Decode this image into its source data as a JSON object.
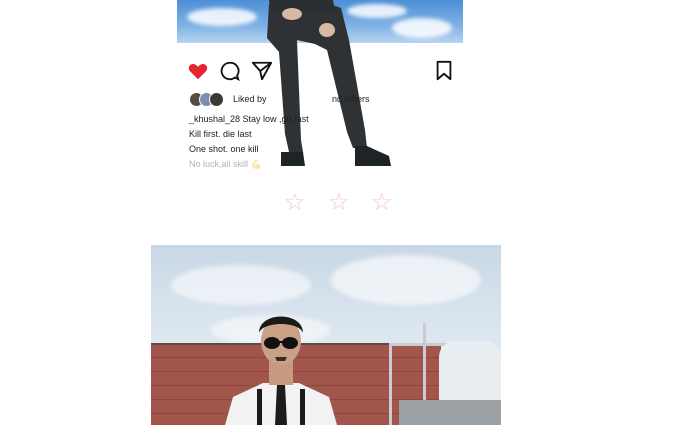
{
  "post_top": {
    "actions": [
      {
        "name": "like",
        "icon": "heart-icon",
        "color": "#e3262f"
      },
      {
        "name": "comment",
        "icon": "comment-icon"
      },
      {
        "name": "share",
        "icon": "send-icon"
      },
      {
        "name": "save",
        "icon": "bookmark-icon"
      }
    ],
    "liked_by_label": "Liked by",
    "liked_others_label": "nd others",
    "caption_lines": [
      "_khushal_28 Stay low ,go fast",
      "Kill first. die last",
      "One shot. one kill",
      "No luck,all skill 💪"
    ]
  },
  "divider": {
    "stars": [
      "☆",
      "☆",
      "☆"
    ],
    "color": "#f3c8cf"
  },
  "post_bottom": {
    "alt": "photo"
  }
}
